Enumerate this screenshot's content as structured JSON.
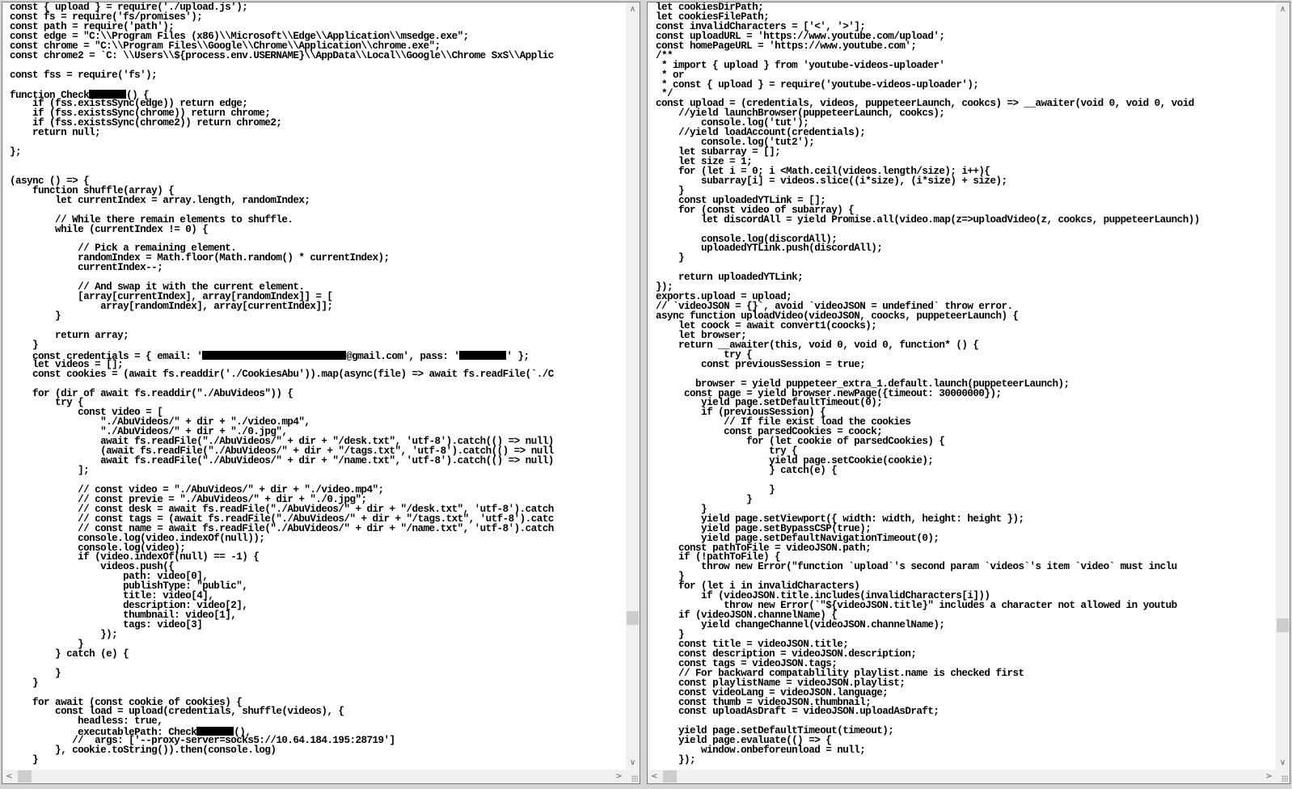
{
  "left_editor": {
    "lines": [
      "const { upload } = require('./upload.js');",
      "const fs = require('fs/promises');",
      "const path = require('path');",
      "const edge = \"C:\\\\Program Files (x86)\\\\Microsoft\\\\Edge\\\\Application\\\\msedge.exe\";",
      "const chrome = \"C:\\\\Program Files\\\\Google\\\\Chrome\\\\Application\\\\chrome.exe\";",
      "const chrome2 = `C: \\\\Users\\\\${process.env.USERNAME}\\\\AppData\\\\Local\\\\Google\\\\Chrome SxS\\\\Applic",
      "",
      "const fss = require('fs');",
      "",
      "function Check[REDACTED]() {",
      "    if (fss.existsSync(edge)) return edge;",
      "    if (fss.existsSync(chrome)) return chrome;",
      "    if (fss.existsSync(chrome2)) return chrome2;",
      "    return null;",
      "",
      "};",
      "",
      "",
      "(async () => {",
      "    function shuffle(array) {",
      "        let currentIndex = array.length, randomIndex;",
      "",
      "        // While there remain elements to shuffle.",
      "        while (currentIndex != 0) {",
      "",
      "            // Pick a remaining element.",
      "            randomIndex = Math.floor(Math.random() * currentIndex);",
      "            currentIndex--;",
      "",
      "            // And swap it with the current element.",
      "            [array[currentIndex], array[randomIndex]] = [",
      "                array[randomIndex], array[currentIndex]];",
      "        }",
      "",
      "        return array;",
      "    }",
      "    const credentials = { email: '[REDACTED]@gmail.com', pass: '[REDACTED]' };",
      "    let videos = [];",
      "    const cookies = (await fs.readdir('./CookiesAbu')).map(async(file) => await fs.readFile(`./C",
      "",
      "    for (dir of await fs.readdir(\"./AbuVideos\")) {",
      "        try {",
      "            const video = [",
      "                \"./AbuVideos/\" + dir + \"./video.mp4\",",
      "                \"./AbuVideos/\" + dir + \"./0.jpg\",",
      "                await fs.readFile(\"./AbuVideos/\" + dir + \"/desk.txt\", 'utf-8').catch(() => null)",
      "                (await fs.readFile(\"./AbuVideos/\" + dir + \"/tags.txt\", 'utf-8').catch(() => null",
      "                await fs.readFile(\"./AbuVideos/\" + dir + \"/name.txt\", 'utf-8').catch(() => null)",
      "            ];",
      "",
      "            // const video = \"./AbuVideos/\" + dir + \"./video.mp4\";",
      "            // const previe = \"./AbuVideos/\" + dir + \"./0.jpg\";",
      "            // const desk = await fs.readFile(\"./AbuVideos/\" + dir + \"/desk.txt\", 'utf-8').catch",
      "            // const tags = (await fs.readFile(\"./AbuVideos/\" + dir + \"/tags.txt\", 'utf-8').catc",
      "            // const name = await fs.readFile(\"./AbuVideos/\" + dir + \"/name.txt\", 'utf-8').catch",
      "            console.log(video.indexOf(null));",
      "            console.log(video);",
      "            if (video.indexOf(null) == -1) {",
      "                videos.push({",
      "                    path: video[0],",
      "                    publishType: \"public\",",
      "                    title: video[4],",
      "                    description: video[2],",
      "                    thumbnail: video[1],",
      "                    tags: video[3]",
      "                });",
      "            }",
      "        } catch (e) {",
      "",
      "        }",
      "    }",
      "",
      "    for await (const cookie of cookies) {",
      "        const load = upload(credentials, shuffle(videos), {",
      "            headless: true,",
      "            executablePath: Check[REDACTED](),",
      "           //  args: ['--proxy-server=socks5://10.64.184.195:28719']",
      "        }, cookie.toString()).then(console.log)",
      "    }"
    ]
  },
  "right_editor": {
    "lines": [
      "let cookiesDirPath;",
      "let cookiesFilePath;",
      "const invalidCharacters = ['<', '>'];",
      "const uploadURL = 'https://www.youtube.com/upload';",
      "const homePageURL = 'https://www.youtube.com';",
      "/**",
      " * import { upload } from 'youtube-videos-uploader'",
      " * or",
      " * const { upload } = require('youtube-videos-uploader');",
      " */",
      "const upload = (credentials, videos, puppeteerLaunch, cookcs) => __awaiter(void 0, void 0, void",
      "    //yield launchBrowser(puppeteerLaunch, cookcs);",
      "        console.log('tut');",
      "    //yield loadAccount(credentials);",
      "        console.log('tut2');",
      "    let subarray = [];",
      "    let size = 1;",
      "    for (let i = 0; i <Math.ceil(videos.length/size); i++){",
      "        subarray[i] = videos.slice((i*size), (i*size) + size);",
      "    }",
      "    const uploadedYTLink = [];",
      "    for (const video of subarray) {",
      "        let discordAll = yield Promise.all(video.map(z=>uploadVideo(z, cookcs, puppeteerLaunch))",
      "",
      "        console.log(discordAll);",
      "        uploadedYTLink.push(discordAll);",
      "    }",
      "",
      "    return uploadedYTLink;",
      "});",
      "exports.upload = upload;",
      "// `videoJSON = {}`, avoid `videoJSON = undefined` throw error.",
      "async function uploadVideo(videoJSON, coocks, puppeteerLaunch) {",
      "    let coock = await convert1(coocks);",
      "    let browser;",
      "    return __awaiter(this, void 0, void 0, function* () {",
      "            try {",
      "        const previousSession = true;",
      "",
      "       browser = yield puppeteer_extra_1.default.launch(puppeteerLaunch);",
      "     const page = yield browser.newPage({timeout: 30000000});",
      "        yield page.setDefaultTimeout(0);",
      "        if (previousSession) {",
      "            // If file exist load the cookies",
      "            const parsedCookies = coock;",
      "                for (let cookie of parsedCookies) {",
      "                    try {",
      "                    yield page.setCookie(cookie);",
      "                    } catch(e) {",
      "",
      "                    }",
      "                }",
      "        }",
      "        yield page.setViewport({ width: width, height: height });",
      "        yield page.setBypassCSP(true);",
      "        yield page.setDefaultNavigationTimeout(0);",
      "    const pathToFile = videoJSON.path;",
      "    if (!pathToFile) {",
      "        throw new Error(\"function `upload`'s second param `videos`'s item `video` must inclu",
      "    }",
      "    for (let i in invalidCharacters)",
      "        if (videoJSON.title.includes(invalidCharacters[i]))",
      "            throw new Error(`\"${videoJSON.title}\" includes a character not allowed in youtub",
      "    if (videoJSON.channelName) {",
      "        yield changeChannel(videoJSON.channelName);",
      "    }",
      "    const title = videoJSON.title;",
      "    const description = videoJSON.description;",
      "    const tags = videoJSON.tags;",
      "    // For backward compatablility playlist.name is checked first",
      "    const playlistName = videoJSON.playlist;",
      "    const videoLang = videoJSON.language;",
      "    const thumb = videoJSON.thumbnail;",
      "    const uploadAsDraft = videoJSON.uploadAsDraft;",
      "",
      "    yield page.setDefaultTimeout(timeout);",
      "    yield page.evaluate(() => {",
      "        window.onbeforeunload = null;",
      "    });"
    ]
  },
  "scrollbars": {
    "left_vertical_position": 0.82,
    "right_vertical_position": 0.83,
    "left_horizontal_position": 0.0,
    "right_horizontal_position": 0.0
  },
  "icons": {
    "up": "∧",
    "down": "∨",
    "left": "<",
    "right": ">"
  }
}
